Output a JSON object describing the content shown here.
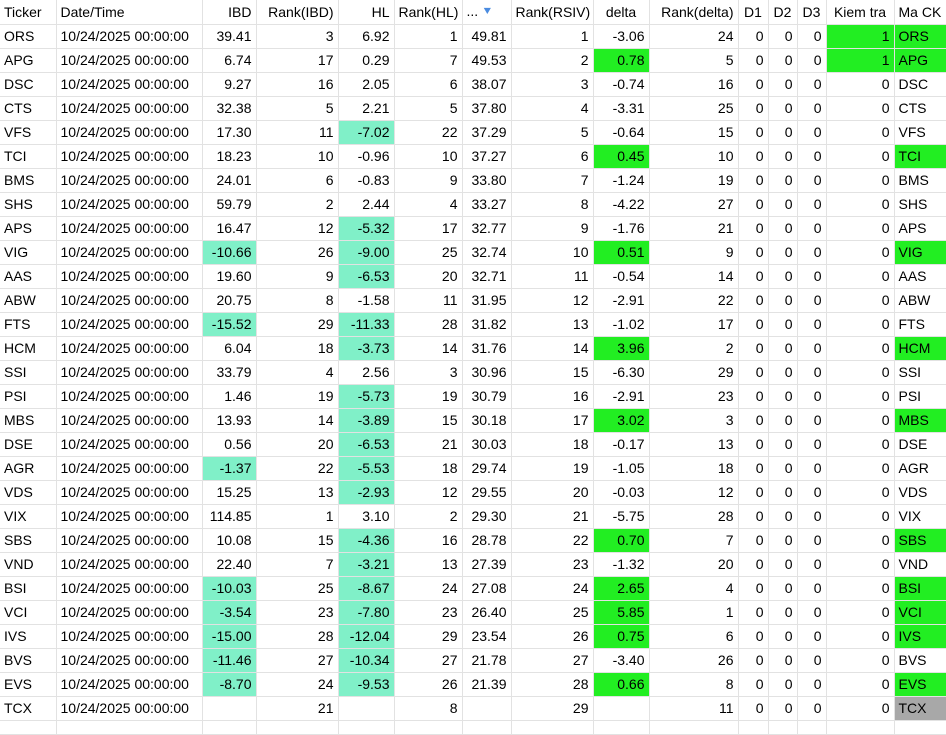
{
  "headers": [
    "Ticker",
    "Date/Time",
    "IBD",
    "Rank(IBD)",
    "HL",
    "Rank(HL)",
    "...",
    "Rank(RSIV)",
    "delta",
    "Rank(delta)",
    "D1",
    "D2",
    "D3",
    "Kiem tra",
    "Ma CK"
  ],
  "sort_icon": "sort-descending-icon",
  "colors": {
    "teal": "#80f0c8",
    "green": "#22ee22",
    "gray": "#a8a8a8"
  },
  "rows": [
    [
      "ORS",
      "10/24/2025 00:00:00",
      "39.41",
      "3",
      "6.92",
      "1",
      "49.81",
      "1",
      "-3.06",
      "24",
      "0",
      "0",
      "0",
      "1",
      "ORS"
    ],
    [
      "APG",
      "10/24/2025 00:00:00",
      "6.74",
      "17",
      "0.29",
      "7",
      "49.53",
      "2",
      "0.78",
      "5",
      "0",
      "0",
      "0",
      "1",
      "APG"
    ],
    [
      "DSC",
      "10/24/2025 00:00:00",
      "9.27",
      "16",
      "2.05",
      "6",
      "38.07",
      "3",
      "-0.74",
      "16",
      "0",
      "0",
      "0",
      "0",
      "DSC"
    ],
    [
      "CTS",
      "10/24/2025 00:00:00",
      "32.38",
      "5",
      "2.21",
      "5",
      "37.80",
      "4",
      "-3.31",
      "25",
      "0",
      "0",
      "0",
      "0",
      "CTS"
    ],
    [
      "VFS",
      "10/24/2025 00:00:00",
      "17.30",
      "11",
      "-7.02",
      "22",
      "37.29",
      "5",
      "-0.64",
      "15",
      "0",
      "0",
      "0",
      "0",
      "VFS"
    ],
    [
      "TCI",
      "10/24/2025 00:00:00",
      "18.23",
      "10",
      "-0.96",
      "10",
      "37.27",
      "6",
      "0.45",
      "10",
      "0",
      "0",
      "0",
      "0",
      "TCI"
    ],
    [
      "BMS",
      "10/24/2025 00:00:00",
      "24.01",
      "6",
      "-0.83",
      "9",
      "33.80",
      "7",
      "-1.24",
      "19",
      "0",
      "0",
      "0",
      "0",
      "BMS"
    ],
    [
      "SHS",
      "10/24/2025 00:00:00",
      "59.79",
      "2",
      "2.44",
      "4",
      "33.27",
      "8",
      "-4.22",
      "27",
      "0",
      "0",
      "0",
      "0",
      "SHS"
    ],
    [
      "APS",
      "10/24/2025 00:00:00",
      "16.47",
      "12",
      "-5.32",
      "17",
      "32.77",
      "9",
      "-1.76",
      "21",
      "0",
      "0",
      "0",
      "0",
      "APS"
    ],
    [
      "VIG",
      "10/24/2025 00:00:00",
      "-10.66",
      "26",
      "-9.00",
      "25",
      "32.74",
      "10",
      "0.51",
      "9",
      "0",
      "0",
      "0",
      "0",
      "VIG"
    ],
    [
      "AAS",
      "10/24/2025 00:00:00",
      "19.60",
      "9",
      "-6.53",
      "20",
      "32.71",
      "11",
      "-0.54",
      "14",
      "0",
      "0",
      "0",
      "0",
      "AAS"
    ],
    [
      "ABW",
      "10/24/2025 00:00:00",
      "20.75",
      "8",
      "-1.58",
      "11",
      "31.95",
      "12",
      "-2.91",
      "22",
      "0",
      "0",
      "0",
      "0",
      "ABW"
    ],
    [
      "FTS",
      "10/24/2025 00:00:00",
      "-15.52",
      "29",
      "-11.33",
      "28",
      "31.82",
      "13",
      "-1.02",
      "17",
      "0",
      "0",
      "0",
      "0",
      "FTS"
    ],
    [
      "HCM",
      "10/24/2025 00:00:00",
      "6.04",
      "18",
      "-3.73",
      "14",
      "31.76",
      "14",
      "3.96",
      "2",
      "0",
      "0",
      "0",
      "0",
      "HCM"
    ],
    [
      "SSI",
      "10/24/2025 00:00:00",
      "33.79",
      "4",
      "2.56",
      "3",
      "30.96",
      "15",
      "-6.30",
      "29",
      "0",
      "0",
      "0",
      "0",
      "SSI"
    ],
    [
      "PSI",
      "10/24/2025 00:00:00",
      "1.46",
      "19",
      "-5.73",
      "19",
      "30.79",
      "16",
      "-2.91",
      "23",
      "0",
      "0",
      "0",
      "0",
      "PSI"
    ],
    [
      "MBS",
      "10/24/2025 00:00:00",
      "13.93",
      "14",
      "-3.89",
      "15",
      "30.18",
      "17",
      "3.02",
      "3",
      "0",
      "0",
      "0",
      "0",
      "MBS"
    ],
    [
      "DSE",
      "10/24/2025 00:00:00",
      "0.56",
      "20",
      "-6.53",
      "21",
      "30.03",
      "18",
      "-0.17",
      "13",
      "0",
      "0",
      "0",
      "0",
      "DSE"
    ],
    [
      "AGR",
      "10/24/2025 00:00:00",
      "-1.37",
      "22",
      "-5.53",
      "18",
      "29.74",
      "19",
      "-1.05",
      "18",
      "0",
      "0",
      "0",
      "0",
      "AGR"
    ],
    [
      "VDS",
      "10/24/2025 00:00:00",
      "15.25",
      "13",
      "-2.93",
      "12",
      "29.55",
      "20",
      "-0.03",
      "12",
      "0",
      "0",
      "0",
      "0",
      "VDS"
    ],
    [
      "VIX",
      "10/24/2025 00:00:00",
      "114.85",
      "1",
      "3.10",
      "2",
      "29.30",
      "21",
      "-5.75",
      "28",
      "0",
      "0",
      "0",
      "0",
      "VIX"
    ],
    [
      "SBS",
      "10/24/2025 00:00:00",
      "10.08",
      "15",
      "-4.36",
      "16",
      "28.78",
      "22",
      "0.70",
      "7",
      "0",
      "0",
      "0",
      "0",
      "SBS"
    ],
    [
      "VND",
      "10/24/2025 00:00:00",
      "22.40",
      "7",
      "-3.21",
      "13",
      "27.39",
      "23",
      "-1.32",
      "20",
      "0",
      "0",
      "0",
      "0",
      "VND"
    ],
    [
      "BSI",
      "10/24/2025 00:00:00",
      "-10.03",
      "25",
      "-8.67",
      "24",
      "27.08",
      "24",
      "2.65",
      "4",
      "0",
      "0",
      "0",
      "0",
      "BSI"
    ],
    [
      "VCI",
      "10/24/2025 00:00:00",
      "-3.54",
      "23",
      "-7.80",
      "23",
      "26.40",
      "25",
      "5.85",
      "1",
      "0",
      "0",
      "0",
      "0",
      "VCI"
    ],
    [
      "IVS",
      "10/24/2025 00:00:00",
      "-15.00",
      "28",
      "-12.04",
      "29",
      "23.54",
      "26",
      "0.75",
      "6",
      "0",
      "0",
      "0",
      "0",
      "IVS"
    ],
    [
      "BVS",
      "10/24/2025 00:00:00",
      "-11.46",
      "27",
      "-10.34",
      "27",
      "21.78",
      "27",
      "-3.40",
      "26",
      "0",
      "0",
      "0",
      "0",
      "BVS"
    ],
    [
      "EVS",
      "10/24/2025 00:00:00",
      "-8.70",
      "24",
      "-9.53",
      "26",
      "21.39",
      "28",
      "0.66",
      "8",
      "0",
      "0",
      "0",
      "0",
      "EVS"
    ],
    [
      "TCX",
      "10/24/2025 00:00:00",
      "",
      "21",
      "",
      "8",
      "",
      "29",
      "",
      "11",
      "0",
      "0",
      "0",
      "0",
      "TCX"
    ]
  ]
}
